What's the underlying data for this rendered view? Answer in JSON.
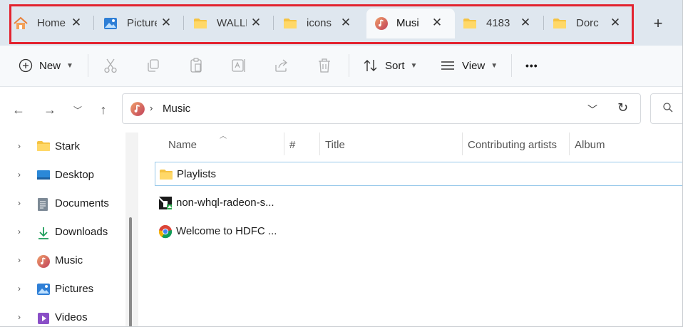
{
  "tabs": [
    {
      "label": "Home",
      "icon": "home-icon"
    },
    {
      "label": "Pictures",
      "icon": "pictures-icon"
    },
    {
      "label": "WALLPAPERS",
      "icon": "folder-icon"
    },
    {
      "label": "icons",
      "icon": "folder-icon"
    },
    {
      "label": "Music",
      "icon": "music-icon",
      "active": true
    },
    {
      "label": "4183",
      "icon": "folder-icon"
    },
    {
      "label": "Dorc",
      "icon": "folder-icon"
    }
  ],
  "toolbar": {
    "new_label": "New",
    "sort_label": "Sort",
    "view_label": "View",
    "more_label": "•••"
  },
  "address": {
    "path": "Music"
  },
  "sidebar": {
    "items": [
      {
        "label": "Stark",
        "icon": "folder-icon"
      },
      {
        "label": "Desktop",
        "icon": "desktop-icon"
      },
      {
        "label": "Documents",
        "icon": "documents-icon"
      },
      {
        "label": "Downloads",
        "icon": "downloads-icon"
      },
      {
        "label": "Music",
        "icon": "music-icon"
      },
      {
        "label": "Pictures",
        "icon": "pictures-icon"
      },
      {
        "label": "Videos",
        "icon": "videos-icon"
      }
    ]
  },
  "columns": [
    "Name",
    "#",
    "Title",
    "Contributing artists",
    "Album"
  ],
  "files": [
    {
      "name": "Playlists",
      "icon": "folder-icon"
    },
    {
      "name": "non-whql-radeon-s...",
      "icon": "amd-installer-icon"
    },
    {
      "name": "Welcome to HDFC ...",
      "icon": "chrome-icon"
    }
  ],
  "colors": {
    "accent_highlight": "#e3232f",
    "tabstrip_bg": "#dfe7ef",
    "folder_yellow": "#f5c343",
    "selection_border": "#99c9ea"
  }
}
